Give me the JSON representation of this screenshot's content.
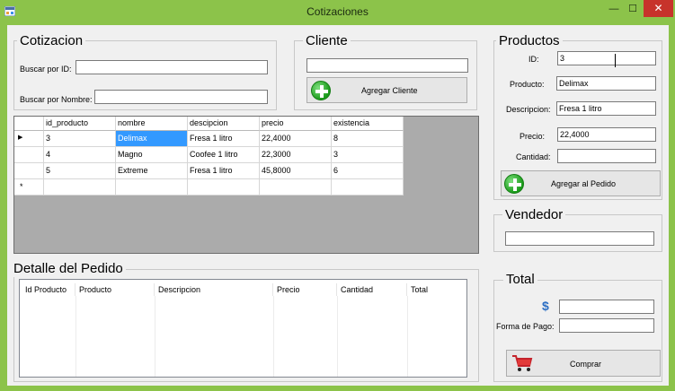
{
  "window": {
    "title": "Cotizaciones",
    "minimize": "—",
    "maximize": "☐",
    "close": "✕"
  },
  "cotizacion": {
    "title": "Cotizacion",
    "buscar_id_label": "Buscar por ID:",
    "buscar_id_value": "",
    "buscar_nombre_label": "Buscar por Nombre:",
    "buscar_nombre_value": ""
  },
  "cliente": {
    "title": "Cliente",
    "value": "",
    "button": "Agregar Cliente"
  },
  "productos": {
    "title": "Productos",
    "id_label": "ID:",
    "id_value": "3",
    "producto_label": "Producto:",
    "producto_value": "Delimax",
    "descripcion_label": "Descripcion:",
    "descripcion_value": "Fresa 1 litro",
    "precio_label": "Precio:",
    "precio_value": "22,4000",
    "cantidad_label": "Cantidad:",
    "cantidad_value": "",
    "button": "Agregar al Pedido"
  },
  "grid": {
    "columns": [
      "id_producto",
      "nombre",
      "descipcion",
      "precio",
      "existencia"
    ],
    "rows": [
      [
        "3",
        "Delimax",
        "Fresa 1 litro",
        "22,4000",
        "8"
      ],
      [
        "4",
        "Magno",
        "Coofee 1 litro",
        "22,3000",
        "3"
      ],
      [
        "5",
        "Extreme",
        "Fresa 1 litro",
        "45,8000",
        "6"
      ],
      [
        "",
        "",
        "",
        "",
        ""
      ]
    ],
    "current_row_marker": "▶",
    "new_row_marker": "*"
  },
  "vendedor": {
    "title": "Vendedor",
    "value": ""
  },
  "detalle": {
    "title": "Detalle del Pedido",
    "columns": [
      "Id Producto",
      "Producto",
      "Descripcion",
      "Precio",
      "Cantidad",
      "Total"
    ]
  },
  "total": {
    "title": "Total",
    "currency_symbol": "$",
    "total_value": "",
    "forma_pago_label": "Forma de Pago:",
    "forma_pago_value": "",
    "button": "Comprar"
  },
  "colors": {
    "window_frame": "#8cc34a",
    "selection": "#3399ff",
    "close_button": "#c7332b"
  }
}
